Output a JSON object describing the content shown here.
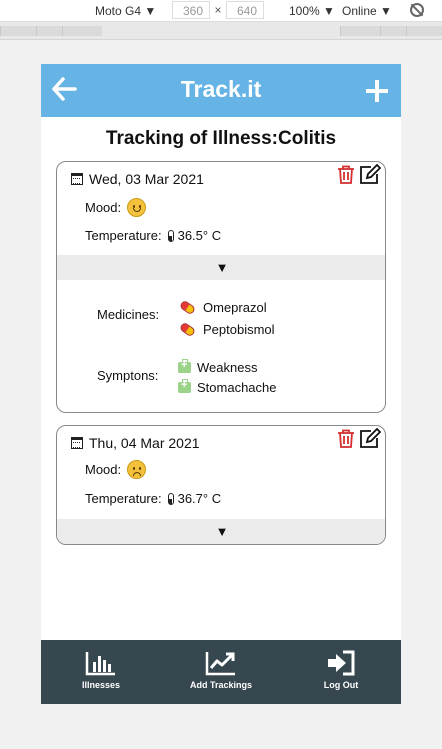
{
  "devtools": {
    "device": "Moto G4 ▼",
    "width": "360",
    "times": "×",
    "height": "640",
    "zoom": "100% ▼",
    "network": "Online ▼"
  },
  "header": {
    "title": "Track.it",
    "color": "#66b3e6"
  },
  "page_title": "Tracking of Illness:Colitis",
  "cards": [
    {
      "date": "Wed, 03 Mar 2021",
      "mood_label": "Mood:",
      "mood": "happy",
      "temperature_label": "Temperature:",
      "temperature": "36.5° C",
      "expand_glyph": "▼",
      "medicines_label": "Medicines:",
      "medicines": [
        "Omeprazol",
        "Peptobismol"
      ],
      "symptoms_label": "Symptons:",
      "symptoms": [
        "Weakness",
        "Stomachache"
      ]
    },
    {
      "date": "Thu, 04 Mar 2021",
      "mood_label": "Mood:",
      "mood": "sad",
      "temperature_label": "Temperature:",
      "temperature": "36.7° C",
      "expand_glyph": "▼"
    }
  ],
  "nav": {
    "illnesses": "Illnesses",
    "add_trackings": "Add Trackings",
    "logout": "Log Out",
    "color": "#37474f"
  },
  "icons": {
    "delete": "trash-icon",
    "edit": "edit-icon",
    "calendar": "calendar-icon",
    "thermometer": "thermometer-icon",
    "medicine": "pill-icon",
    "symptom": "medical-kit-icon"
  }
}
